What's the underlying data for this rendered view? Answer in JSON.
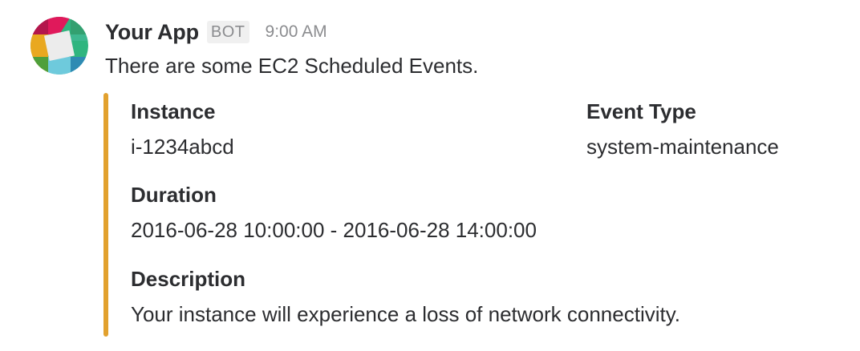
{
  "message": {
    "sender": "Your App",
    "badge": "BOT",
    "timestamp": "9:00 AM",
    "text": "There are some EC2 Scheduled Events.",
    "avatar_icon": "slack-app-logo-icon",
    "attachment": {
      "color": "#e2a12e",
      "fields": {
        "instance": {
          "title": "Instance",
          "value": "i-1234abcd"
        },
        "event_type": {
          "title": "Event Type",
          "value": "system-maintenance"
        },
        "duration": {
          "title": "Duration",
          "value": "2016-06-28 10:00:00 - 2016-06-28 14:00:00"
        },
        "description": {
          "title": "Description",
          "value": "Your instance will experience a loss of network connectivity."
        }
      }
    }
  }
}
